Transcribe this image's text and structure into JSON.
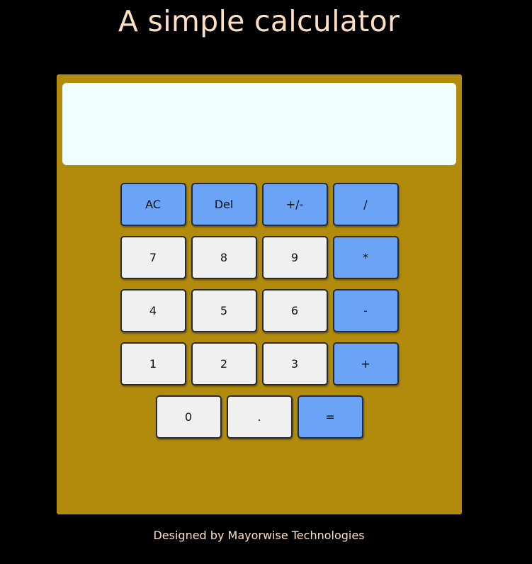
{
  "page": {
    "title": "A simple calculator",
    "footer": "Designed by Mayorwise Technologies"
  },
  "calculator": {
    "display_value": "",
    "colors": {
      "body": "#b28a0c",
      "display": "#f0ffff",
      "operator_key": "#6ba4f6",
      "digit_key": "#f0f0f0"
    },
    "rows": [
      [
        {
          "label": "AC",
          "type": "op",
          "name": "all-clear-button"
        },
        {
          "label": "Del",
          "type": "op",
          "name": "delete-button"
        },
        {
          "label": "+/-",
          "type": "op",
          "name": "sign-toggle-button"
        },
        {
          "label": "/",
          "type": "op",
          "name": "divide-button"
        }
      ],
      [
        {
          "label": "7",
          "type": "digit",
          "name": "digit-7-button"
        },
        {
          "label": "8",
          "type": "digit",
          "name": "digit-8-button"
        },
        {
          "label": "9",
          "type": "digit",
          "name": "digit-9-button"
        },
        {
          "label": "*",
          "type": "op",
          "name": "multiply-button"
        }
      ],
      [
        {
          "label": "4",
          "type": "digit",
          "name": "digit-4-button"
        },
        {
          "label": "5",
          "type": "digit",
          "name": "digit-5-button"
        },
        {
          "label": "6",
          "type": "digit",
          "name": "digit-6-button"
        },
        {
          "label": "-",
          "type": "op",
          "name": "subtract-button"
        }
      ],
      [
        {
          "label": "1",
          "type": "digit",
          "name": "digit-1-button"
        },
        {
          "label": "2",
          "type": "digit",
          "name": "digit-2-button"
        },
        {
          "label": "3",
          "type": "digit",
          "name": "digit-3-button"
        },
        {
          "label": "+",
          "type": "op",
          "name": "add-button"
        }
      ],
      [
        {
          "label": "0",
          "type": "digit",
          "name": "digit-0-button"
        },
        {
          "label": ".",
          "type": "digit",
          "name": "decimal-point-button"
        },
        {
          "label": "=",
          "type": "op",
          "name": "equals-button"
        }
      ]
    ]
  }
}
